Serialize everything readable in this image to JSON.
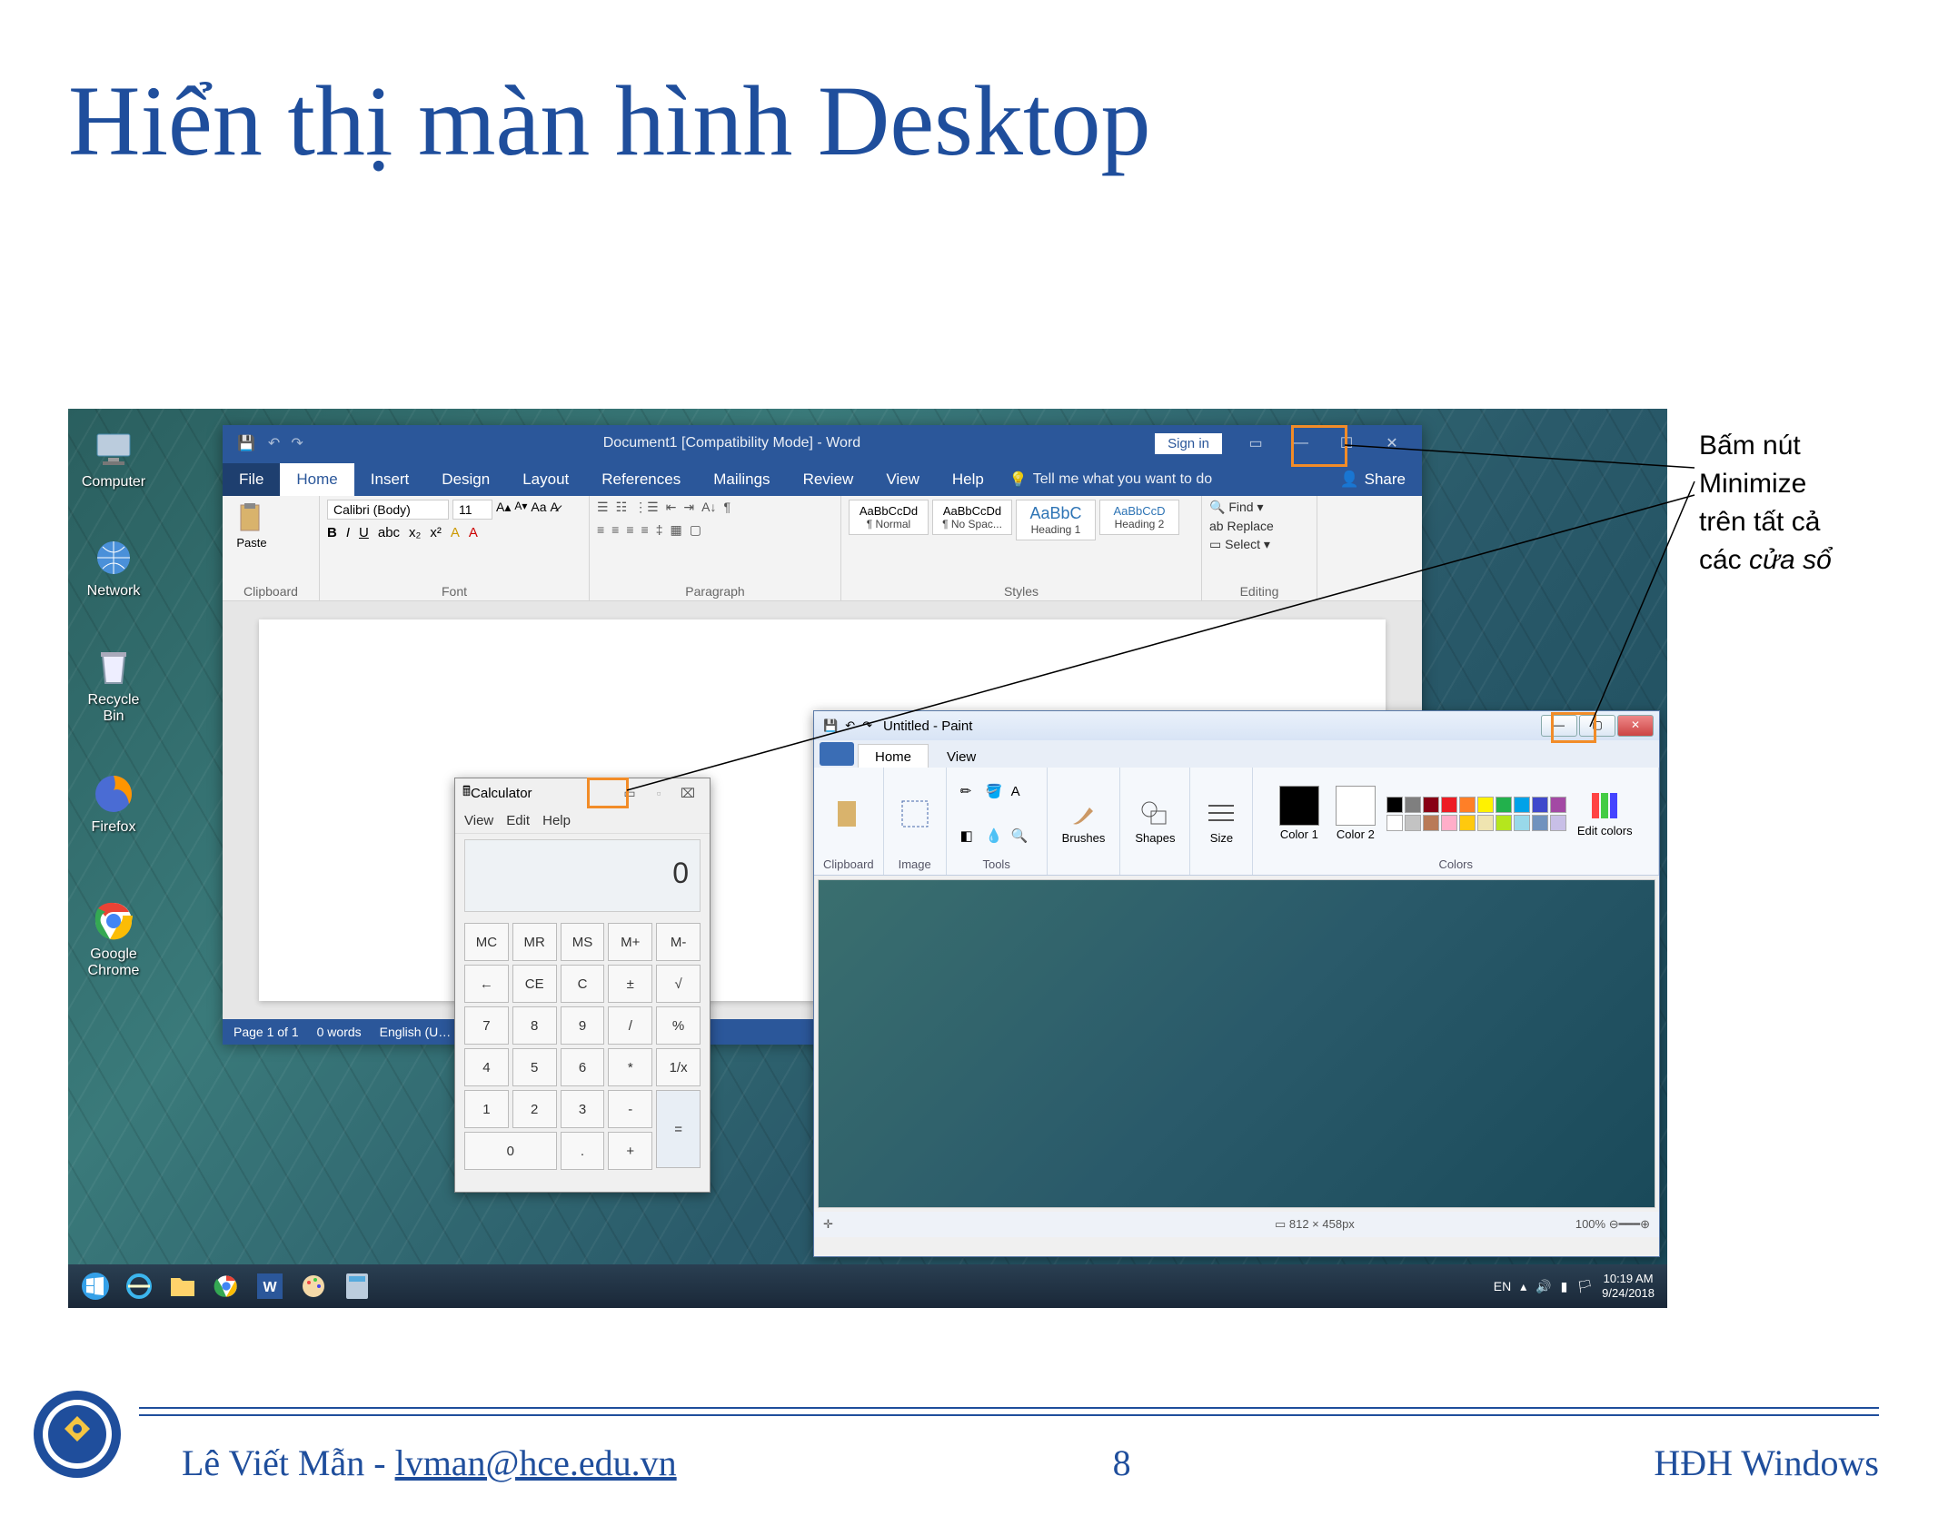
{
  "slide": {
    "title": "Hiển thị màn hình Desktop"
  },
  "desktop_icons": [
    {
      "label": "Computer"
    },
    {
      "label": "Network"
    },
    {
      "label": "Recycle Bin"
    },
    {
      "label": "Firefox"
    },
    {
      "label": "Google Chrome"
    }
  ],
  "word": {
    "title": "Document1 [Compatibility Mode] - Word",
    "signin": "Sign in",
    "file": "File",
    "tabs": [
      "Home",
      "Insert",
      "Design",
      "Layout",
      "References",
      "Mailings",
      "Review",
      "View",
      "Help"
    ],
    "tellme": "Tell me what you want to do",
    "share": "Share",
    "groups": {
      "clipboard": "Clipboard",
      "font": "Font",
      "paragraph": "Paragraph",
      "styles": "Styles",
      "editing": "Editing"
    },
    "paste": "Paste",
    "font_name": "Calibri (Body)",
    "font_size": "11",
    "style1_preview": "AaBbCcDd",
    "style1_name": "¶ Normal",
    "style2_preview": "AaBbCcDd",
    "style2_name": "¶ No Spac...",
    "style3_preview": "AaBbC",
    "style3_name": "Heading 1",
    "style4_preview": "AaBbCcD",
    "style4_name": "Heading 2",
    "find": "Find",
    "replace": "Replace",
    "select": "Select",
    "status_page": "Page 1 of 1",
    "status_words": "0 words",
    "status_lang": "English (U…"
  },
  "calc": {
    "title": "Calculator",
    "menu": [
      "View",
      "Edit",
      "Help"
    ],
    "display": "0",
    "keys_row1": [
      "MC",
      "MR",
      "MS",
      "M+",
      "M-"
    ],
    "keys_row2": [
      "←",
      "CE",
      "C",
      "±",
      "√"
    ],
    "keys_row3": [
      "7",
      "8",
      "9",
      "/",
      "%"
    ],
    "keys_row4": [
      "4",
      "5",
      "6",
      "*",
      "1/x"
    ],
    "keys_row5": [
      "1",
      "2",
      "3",
      "-",
      "="
    ],
    "keys_row6": [
      "0",
      ".",
      "+"
    ]
  },
  "paint": {
    "title": "Untitled - Paint",
    "tabs": [
      "Home",
      "View"
    ],
    "groups": {
      "clipboard": "Clipboard",
      "image": "Image",
      "tools": "Tools",
      "brushes": "Brushes",
      "shapes": "Shapes",
      "size": "Size",
      "colors": "Colors"
    },
    "color1": "Color 1",
    "color2": "Color 2",
    "edit_colors": "Edit colors",
    "status_size": "812 × 458px",
    "status_zoom": "100%",
    "palette": [
      "#000",
      "#7f7f7f",
      "#880015",
      "#ed1c24",
      "#ff7f27",
      "#fff200",
      "#22b14c",
      "#00a2e8",
      "#3f48cc",
      "#a349a4",
      "#fff",
      "#c3c3c3",
      "#b97a57",
      "#ffaec9",
      "#ffc90e",
      "#efe4b0",
      "#b5e61d",
      "#99d9ea",
      "#7092be",
      "#c8bfe7"
    ]
  },
  "taskbar": {
    "lang": "EN",
    "time": "10:19 AM",
    "date": "9/24/2018"
  },
  "callout": {
    "line1": "Bấm nút",
    "line2": "Minimize",
    "line3": "trên tất cả",
    "line4": "các ",
    "line4_italic": "cửa sổ"
  },
  "footer": {
    "author": "Lê Viết Mẫn - ",
    "email": "lvman@hce.edu.vn",
    "page": "8",
    "course": "HĐH Windows"
  }
}
